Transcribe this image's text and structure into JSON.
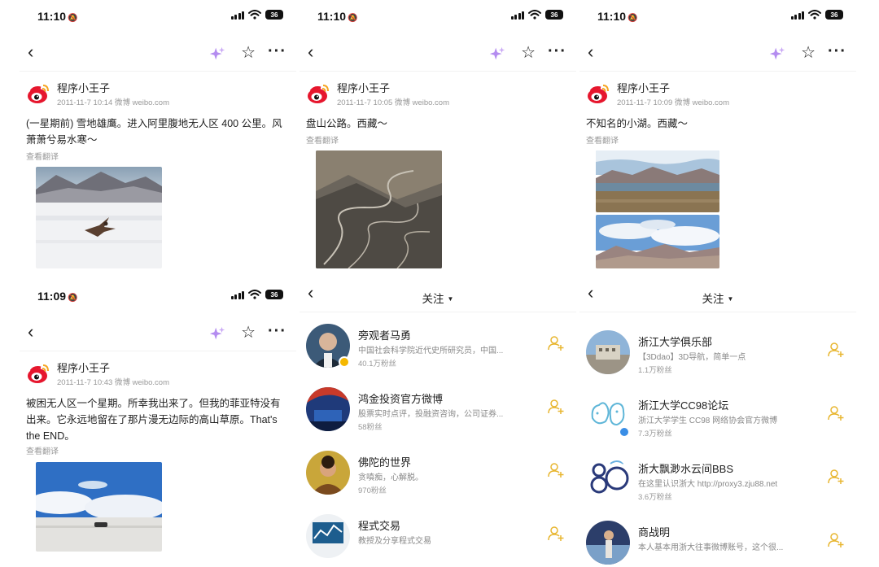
{
  "status_bars": [
    {
      "time": "11:10",
      "battery": "36"
    },
    {
      "time": "11:10",
      "battery": "36"
    },
    {
      "time": "11:10",
      "battery": "36"
    },
    {
      "time": "11:09",
      "battery": "36"
    }
  ],
  "posts": [
    {
      "author": "程序小王子",
      "meta": "2011-11-7 10:14  微博 weibo.com",
      "text": "(一星期前) 雪地雄鹰。进入阿里腹地无人区 400 公里。风萧萧兮易水寒～",
      "translate": "查看翻译"
    },
    {
      "author": "程序小王子",
      "meta": "2011-11-7 10:05  微博 weibo.com",
      "text": "盘山公路。西藏～",
      "translate": "查看翻译"
    },
    {
      "author": "程序小王子",
      "meta": "2011-11-7 10:09  微博 weibo.com",
      "text": "不知名的小湖。西藏～",
      "translate": "查看翻译"
    },
    {
      "author": "程序小王子",
      "meta": "2011-11-7 10:43  微博 weibo.com",
      "text": "被困无人区一个星期。所幸我出来了。但我的菲亚特没有出来。它永远地留在了那片漫无边际的高山草原。That's the END。",
      "translate": "查看翻译"
    }
  ],
  "follow_lists": [
    {
      "title": "关注",
      "items": [
        {
          "name": "旁观者马勇",
          "desc": "中国社会科学院近代史所研究员，中国...",
          "fans": "40.1万粉丝"
        },
        {
          "name": "鸿金投资官方微博",
          "desc": "股票实时点评，投融资咨询，公司证券...",
          "fans": "58粉丝"
        },
        {
          "name": "佛陀的世界",
          "desc": "贪嗔痴，心解脱。",
          "fans": "970粉丝"
        },
        {
          "name": "程式交易",
          "desc": "教授及分享程式交易",
          "fans": ""
        }
      ]
    },
    {
      "title": "关注",
      "items": [
        {
          "name": "浙江大学俱乐部",
          "desc": "【3Ddao】3D导航，简单一点",
          "fans": "1.1万粉丝"
        },
        {
          "name": "浙江大学CC98论坛",
          "desc": "浙江大学学生 CC98 网络协会官方微博",
          "fans": "7.3万粉丝"
        },
        {
          "name": "浙大飘渺水云间BBS",
          "desc": "在这里认识浙大 http://proxy3.zju88.net",
          "fans": "3.6万粉丝"
        },
        {
          "name": "商战明",
          "desc": "本人基本用浙大往事微博账号，这个很...",
          "fans": ""
        }
      ]
    }
  ],
  "icons": {
    "back": "chevron-left-icon",
    "ai": "sparkle-icon",
    "favorite": "star-icon",
    "more": "more-icon",
    "follow": "add-follow-icon"
  },
  "colors": {
    "sparkle": "#b48cf0",
    "follow_icon": "#e8b630",
    "weibo_red": "#e6162d"
  }
}
